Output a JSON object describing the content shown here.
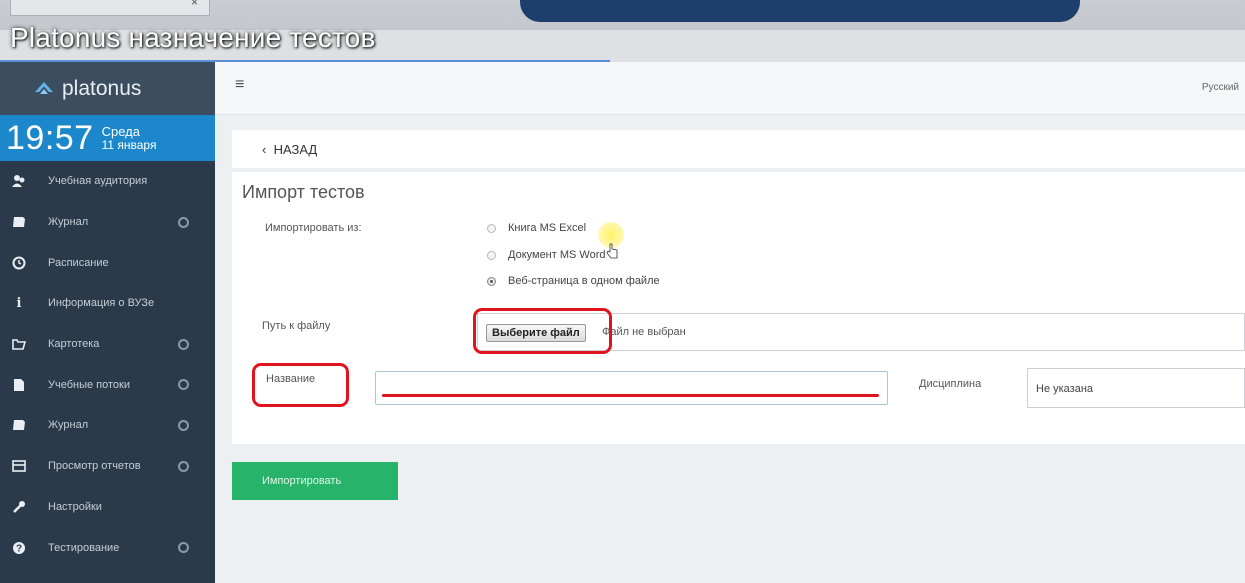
{
  "video": {
    "title": "Platonus назначение тестов"
  },
  "sidebar": {
    "logo": "platonus",
    "clock": {
      "time": "19:57",
      "weekday": "Среда",
      "date": "11 января"
    },
    "items": [
      {
        "label": "Учебная аудитория",
        "icon": "users-icon",
        "chevron": false
      },
      {
        "label": "Журнал",
        "icon": "book-icon",
        "chevron": true
      },
      {
        "label": "Расписание",
        "icon": "clock-icon",
        "chevron": false
      },
      {
        "label": "Информация о ВУЗе",
        "icon": "info-icon",
        "chevron": false
      },
      {
        "label": "Картотека",
        "icon": "folder-icon",
        "chevron": true
      },
      {
        "label": "Учебные потоки",
        "icon": "file-icon",
        "chevron": true
      },
      {
        "label": "Журнал",
        "icon": "book-icon",
        "chevron": true
      },
      {
        "label": "Просмотр отчетов",
        "icon": "table-icon",
        "chevron": true
      },
      {
        "label": "Настройки",
        "icon": "wrench-icon",
        "chevron": false
      },
      {
        "label": "Тестирование",
        "icon": "question-icon",
        "chevron": true
      }
    ]
  },
  "topbar": {
    "language": "Русский"
  },
  "page": {
    "back": "НАЗАД",
    "title": "Импорт тестов",
    "import_from_label": "Импортировать из:",
    "options": [
      {
        "label": "Книга MS Excel",
        "checked": false
      },
      {
        "label": "Документ MS Word",
        "checked": false
      },
      {
        "label": "Веб-страница в одном файле",
        "checked": true
      }
    ],
    "file_path_label": "Путь к файлу",
    "file_button": "Выберите файл",
    "file_status": "Файл не выбран",
    "name_label": "Название",
    "name_value": "",
    "discipline_label": "Дисциплина",
    "discipline_value": "Не указана",
    "import_button": "Импортировать"
  },
  "colors": {
    "sidebar": "#2b3a4a",
    "clock": "#1d87cb",
    "import_button": "#27b36a",
    "annotation": "#e0131e"
  }
}
